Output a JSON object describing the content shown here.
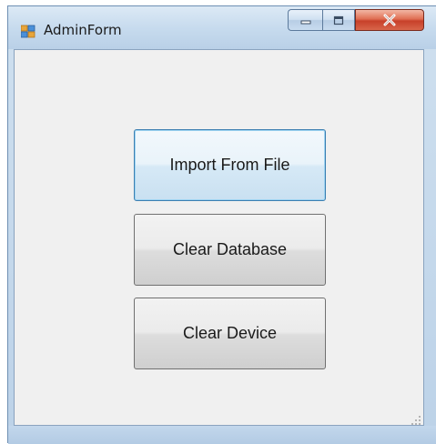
{
  "window": {
    "title": "AdminForm",
    "icon": "app-form-icon"
  },
  "title_buttons": {
    "minimize_icon": "minimize-icon",
    "maximize_icon": "maximize-icon",
    "close_icon": "close-icon"
  },
  "buttons": {
    "import": "Import From File",
    "clear_database": "Clear Database",
    "clear_device": "Clear Device"
  },
  "colors": {
    "focus_border": "#3c7fb1",
    "close_red": "#c7402a"
  }
}
